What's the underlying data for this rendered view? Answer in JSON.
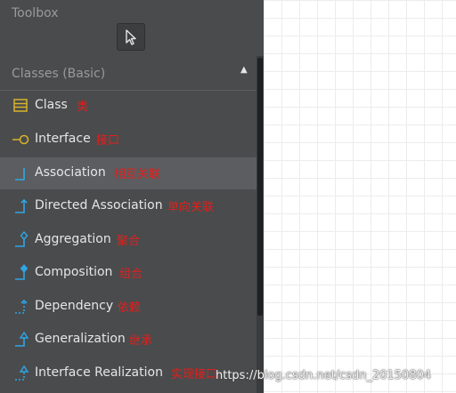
{
  "toolbox": {
    "title": "Toolbox",
    "pointer_tool": "pointer-icon"
  },
  "section": {
    "title": "Classes (Basic)",
    "collapse_icon": "triangle-up-icon"
  },
  "items": [
    {
      "label": "Class",
      "note": "类",
      "icon": "class-icon"
    },
    {
      "label": "Interface",
      "note": "接口",
      "icon": "interface-icon"
    },
    {
      "label": "Association",
      "note": "相互关联",
      "icon": "association-icon",
      "selected": true
    },
    {
      "label": "Directed Association",
      "note": "单向关联",
      "icon": "directed-association-icon"
    },
    {
      "label": "Aggregation",
      "note": "聚合",
      "icon": "aggregation-icon"
    },
    {
      "label": "Composition",
      "note": "组合",
      "icon": "composition-icon"
    },
    {
      "label": "Dependency",
      "note": "依赖",
      "icon": "dependency-icon"
    },
    {
      "label": "Generalization",
      "note": "继承",
      "icon": "generalization-icon"
    },
    {
      "label": "Interface Realization",
      "note": "实现接口",
      "icon": "interface-realization-icon"
    }
  ],
  "watermark": "https://blog.csdn.net/csdn_20150804",
  "colors": {
    "panel": "#4a4b4d",
    "selected_row": "#5b5d60",
    "icon_blue": "#2ea6e6",
    "icon_yellow": "#d7b42a",
    "annotation_red": "#e0201c"
  }
}
